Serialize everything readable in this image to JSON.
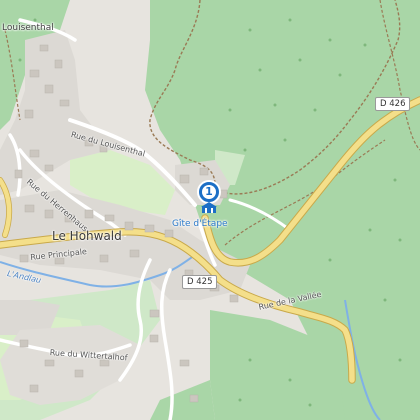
{
  "map": {
    "place_names": {
      "village": "Le Hohwald",
      "locality": "Louisenthal"
    },
    "streets": {
      "rue_du_louisenthal": "Rue du Louisenthal",
      "rue_du_herrenhaus": "Rue du Herrenhaus",
      "rue_principale": "Rue Principale",
      "rue_de_la_vallee": "Rue de la Vallée",
      "rue_du_wittertalhof": "Rue du Wittertalhof"
    },
    "road_numbers": {
      "d425": "D 425",
      "d426": "D 426"
    },
    "waterway": "L'Andlau",
    "poi": {
      "label": "Gîte d'Étape",
      "marker_number": "1",
      "icon": "hostel-icon",
      "marker_color": "#1c6fc6"
    },
    "colors": {
      "forest": "#a9d6a7",
      "meadow": "#d9efc8",
      "residential": "#dedbd6",
      "main_road": "#f4df8a",
      "water": "#7fb1e6",
      "marker": "#1c6fc6"
    }
  }
}
